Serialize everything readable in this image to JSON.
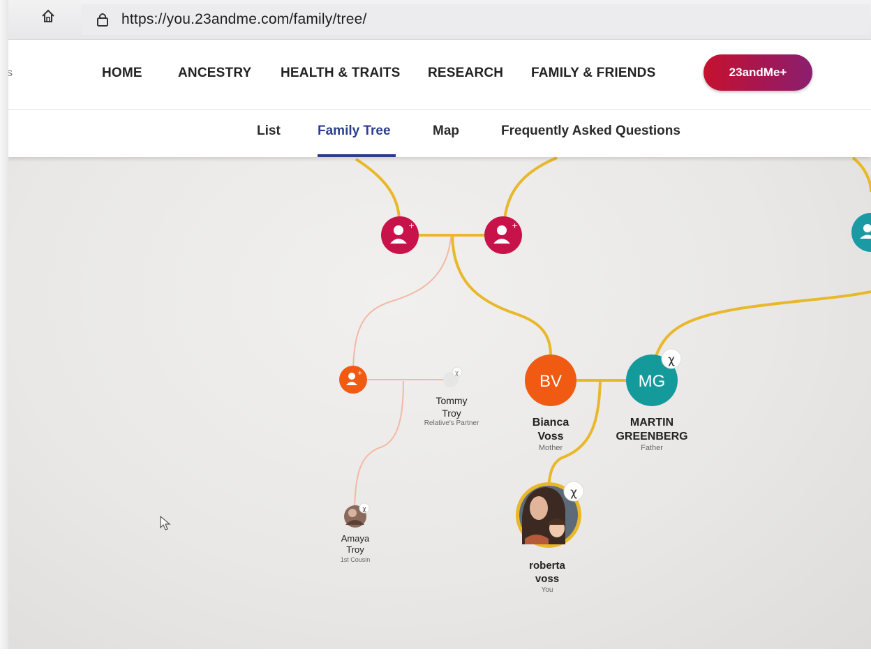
{
  "browser": {
    "url": "https://you.23andme.com/family/tree/"
  },
  "nav": {
    "truncated_left": "s",
    "items": [
      "HOME",
      "ANCESTRY",
      "HEALTH & TRAITS",
      "RESEARCH",
      "FAMILY & FRIENDS"
    ],
    "plus_button": "23andMe+"
  },
  "subnav": {
    "tabs": [
      "List",
      "Family Tree",
      "Map",
      "Frequently Asked Questions"
    ],
    "active": "Family Tree"
  },
  "tree": {
    "nodes": {
      "bianca": {
        "initials": "BV",
        "first": "Bianca",
        "last": "Voss",
        "relation": "Mother",
        "color": "#f05a12"
      },
      "martin": {
        "initials": "MG",
        "first": "MARTIN",
        "last": "GREENBERG",
        "relation": "Father",
        "color": "#159a9c"
      },
      "tommy": {
        "first": "Tommy",
        "last": "Troy",
        "relation": "Relative's Partner"
      },
      "amaya": {
        "first": "Amaya",
        "last": "Troy",
        "relation": "1st Cousin"
      },
      "roberta": {
        "first": "roberta",
        "last": "voss",
        "relation": "You"
      }
    },
    "colors": {
      "line": "#e9b82a",
      "line_faint": "#f2b9a3",
      "add_grandparent": "#c8134a",
      "add_relative": "#f05a12",
      "add_teal": "#1b9aa3"
    }
  }
}
